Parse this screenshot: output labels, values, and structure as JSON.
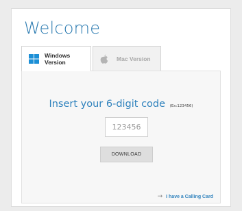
{
  "page": {
    "title": "Welcome"
  },
  "tabs": [
    {
      "label": "Windows Version",
      "icon": "windows-logo-icon",
      "active": true
    },
    {
      "label": "Mac Version",
      "icon": "apple-logo-icon",
      "active": false
    }
  ],
  "code_form": {
    "heading": "Insert your 6-digit code",
    "hint": "(Ex:123456)",
    "input_placeholder": "123456",
    "input_value": ""
  },
  "download_button": {
    "label": "DOWNLOAD"
  },
  "calling_card_link": {
    "arrow": "→",
    "label": "I have a Calling Card"
  },
  "colors": {
    "accent": "#2f82bd",
    "title": "#2a7ab0",
    "panel_bg": "#f7f7f7",
    "button_bg": "#dedede",
    "windows_logo": "#1c8fd6"
  }
}
